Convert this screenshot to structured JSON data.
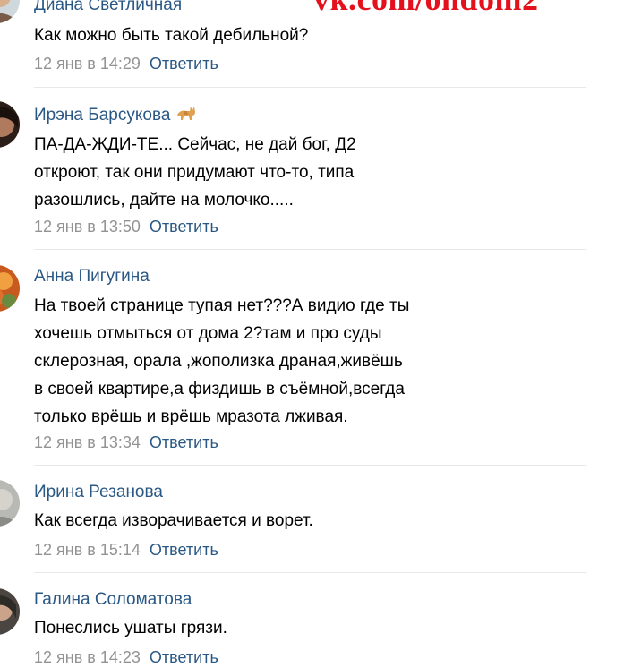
{
  "watermark": "vk.com/ondom2",
  "comments": [
    {
      "author": "Диана Светличная",
      "lines": [
        "Как можно быть такой дебильной?"
      ],
      "date": "12 янв в 14:29",
      "reply": "Ответить",
      "avatar_color": "#c9a88a"
    },
    {
      "author": "Ирэна Барсукова",
      "author_icon": "cat-emoji-icon",
      "lines": [
        "ПА-ДА-ЖДИ-ТЕ... Сейчас, не дай бог, Д2",
        "откроют, так они придумают что-то, типа",
        "разошлись, дайте на молочко....."
      ],
      "date": "12 янв в 13:50",
      "reply": "Ответить",
      "avatar_color": "#3a2a22"
    },
    {
      "author": "Анна Пигугина",
      "lines": [
        "На твоей странице тупая нет???А видио где ты",
        "хочешь отмыться от дома 2?там и про суды",
        "склерозная, орала ,жополизка драная,живёшь",
        "в своей квартире,а физдишь в съёмной,всегда",
        "только врёшь и врёшь мразота лживая."
      ],
      "date": "12 янв в 13:34",
      "reply": "Ответить",
      "avatar_color": "#d0662a"
    },
    {
      "author": "Ирина Резанова",
      "lines": [
        "Как всегда изворачивается и ворет."
      ],
      "date": "12 янв в 15:14",
      "reply": "Ответить",
      "avatar_color": "#a9a9a6"
    },
    {
      "author": "Галина Соломатова",
      "lines": [
        "Понеслись ушаты грязи."
      ],
      "date": "12 янв в 14:23",
      "reply": "Ответить",
      "avatar_color": "#3d3a36"
    }
  ]
}
